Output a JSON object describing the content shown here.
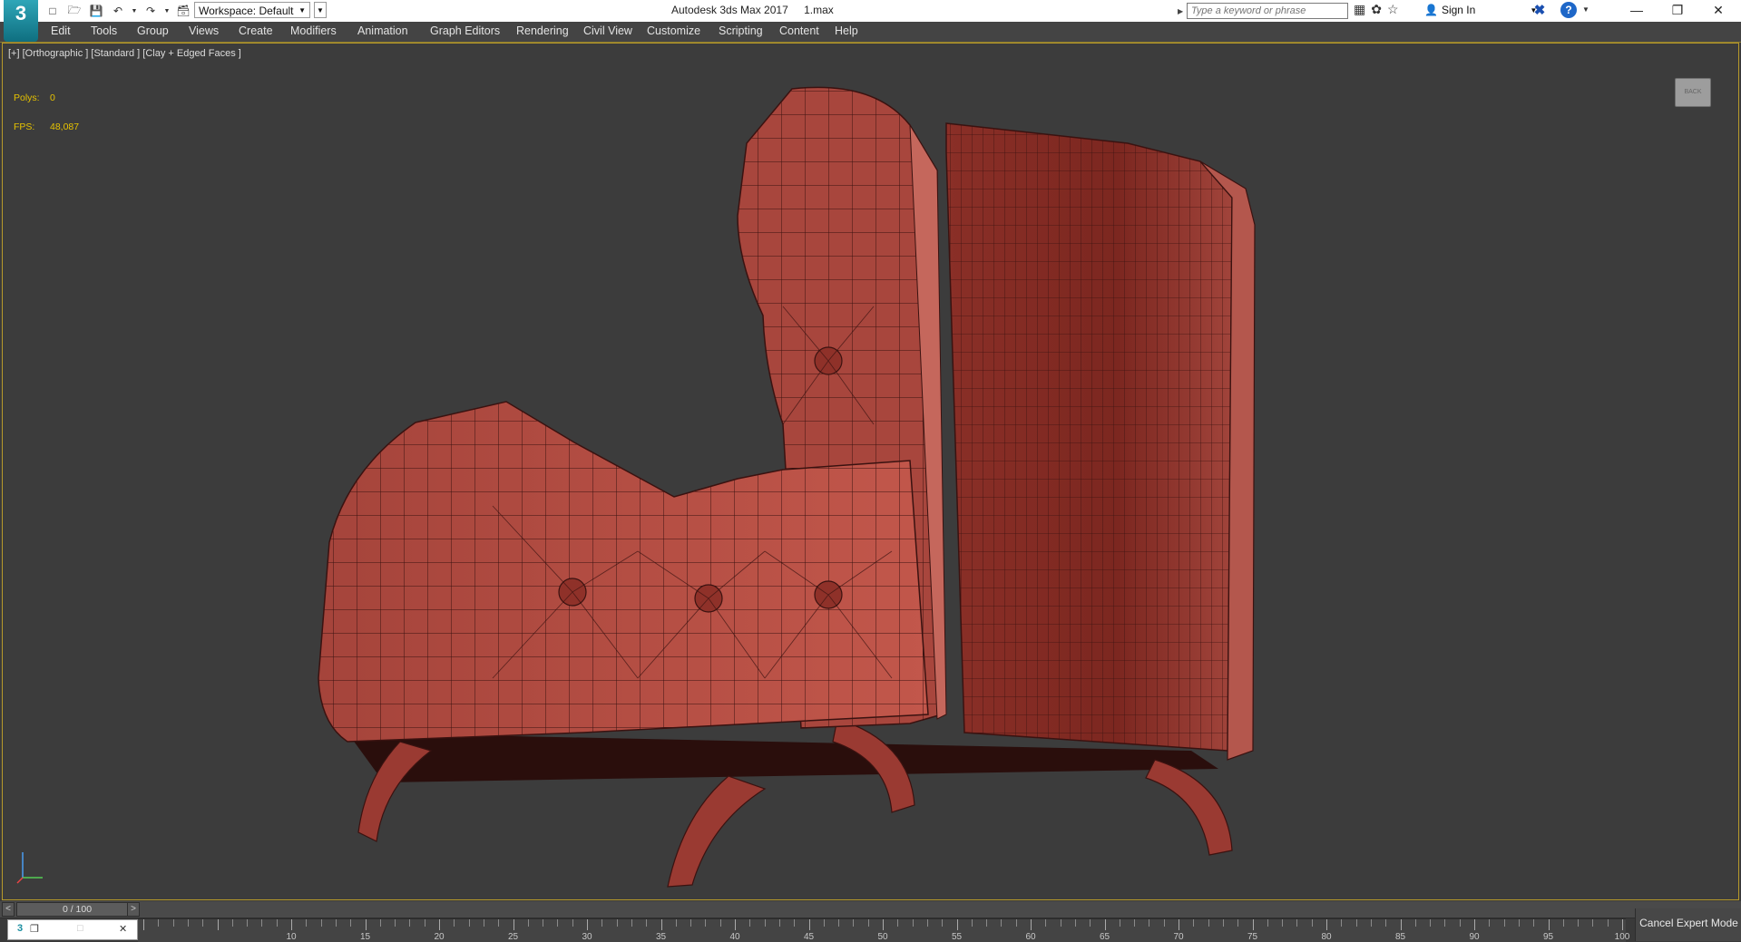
{
  "app": {
    "logo_text": "3",
    "title": "Autodesk 3ds Max 2017",
    "file": "1.max"
  },
  "toolbar": {
    "workspace_label": "Workspace: Default",
    "search_placeholder": "Type a keyword or phrase",
    "sign_in": "Sign In"
  },
  "menu": [
    "Edit",
    "Tools",
    "Group",
    "Views",
    "Create",
    "Modifiers",
    "Animation",
    "Graph Editors",
    "Rendering",
    "Civil View",
    "Customize",
    "Scripting",
    "Content",
    "Help"
  ],
  "viewport": {
    "label": "[+] [Orthographic ] [Standard ] [Clay + Edged Faces ]",
    "stats": [
      {
        "label": "Polys:",
        "value": "0"
      },
      {
        "label": "FPS:",
        "value": "48,087"
      }
    ],
    "viewcube_text": "BACK"
  },
  "timeline": {
    "frame": "0 / 100",
    "prev": "<",
    "next": ">",
    "tick_labels": [
      "10",
      "15",
      "20",
      "25",
      "30",
      "35",
      "40",
      "45",
      "50",
      "55",
      "60",
      "65",
      "70",
      "75",
      "80",
      "85",
      "90",
      "95",
      "100"
    ]
  },
  "status": {
    "cancel_expert": "Cancel Expert Mode"
  },
  "colors": {
    "viewport_bg": "#3c3c3c",
    "model_fill": "#9e3e36",
    "model_edge": "#3a1210",
    "stats_yellow": "#e6c200",
    "active_border": "#b89a2a"
  }
}
